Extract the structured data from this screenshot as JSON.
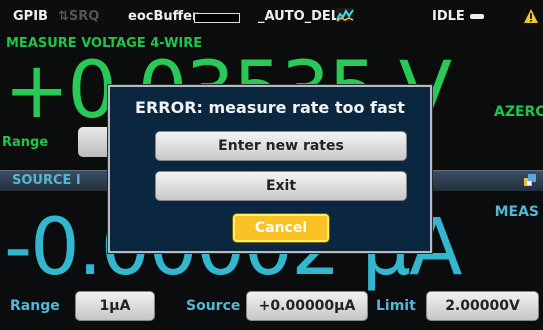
{
  "status_bar": {
    "interface": "GPIB",
    "srq": "SRQ",
    "buffer": "eocBuffer",
    "script": "_AUTO_DEL",
    "state": "IDLE"
  },
  "measure": {
    "title": "MEASURE VOLTAGE 4-WIRE",
    "value": "+0.03535 V",
    "azero": "AZERO",
    "range_label": "Range"
  },
  "source": {
    "tab_label": "SOURCE I",
    "meas_label": "MEAS",
    "value": "-0.00002 µA",
    "range_label": "Range",
    "range_value": "1µA",
    "source_label": "Source",
    "source_value": "+0.00000µA",
    "limit_label": "Limit",
    "limit_value": "2.00000V"
  },
  "dialog": {
    "title": "ERROR: measure rate too fast",
    "buttons": {
      "enter_new_rates": "Enter new rates",
      "exit": "Exit",
      "cancel": "Cancel"
    }
  },
  "colors": {
    "measure_green": "#28c957",
    "source_cyan": "#35b6cf",
    "dialog_bg": "#0b2740",
    "cancel_yellow": "#fac225"
  },
  "icons": [
    "srq-arrows-icon",
    "auto-del-icon",
    "idle-icon",
    "warning-icon",
    "tool-icon"
  ]
}
